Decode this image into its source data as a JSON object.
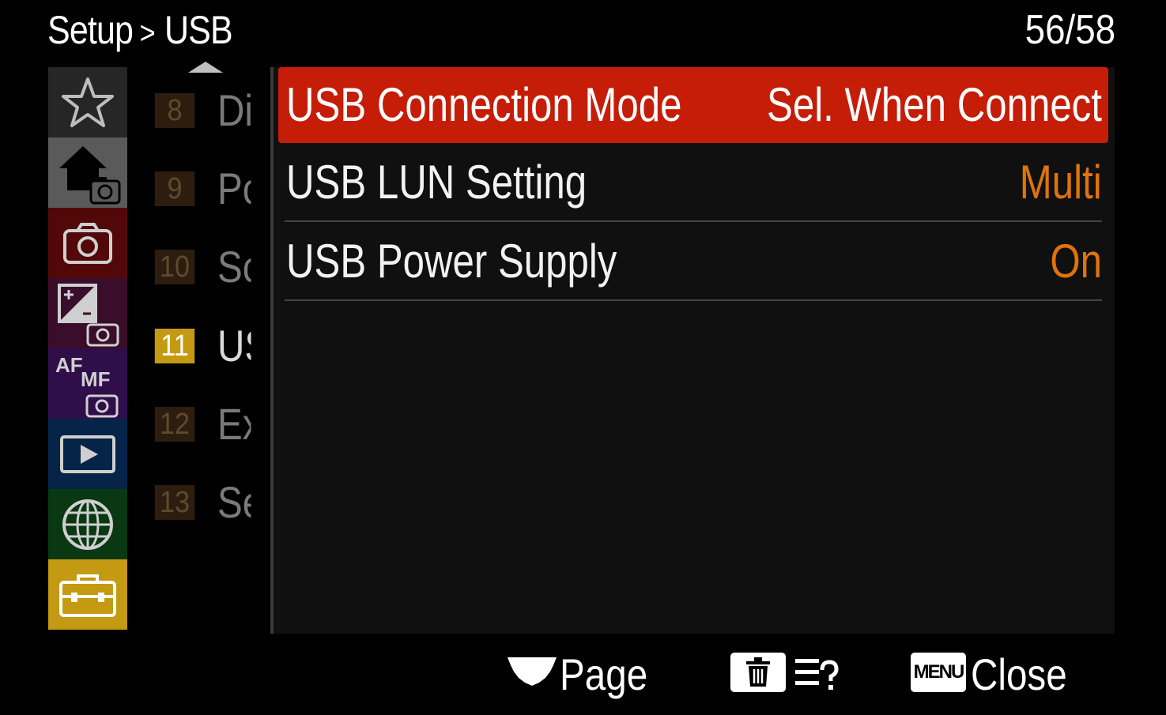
{
  "header": {
    "breadcrumb_parent": "Setup",
    "breadcrumb_separator": ">",
    "breadcrumb_current": "USB",
    "page_counter": "56/58"
  },
  "categories": [
    {
      "icon": "star-icon",
      "color": "#262626"
    },
    {
      "icon": "home-camera-icon",
      "color": "#5a5a5a"
    },
    {
      "icon": "camera-icon",
      "color": "#520808"
    },
    {
      "icon": "exposure-camera-icon",
      "color": "#3a0d2a"
    },
    {
      "icon": "af-mf-camera-icon",
      "color": "#2f0e4a",
      "af": "AF",
      "mf": "MF"
    },
    {
      "icon": "playback-icon",
      "color": "#062448"
    },
    {
      "icon": "globe-icon",
      "color": "#093812"
    },
    {
      "icon": "toolbox-icon",
      "color": "#c49a12"
    }
  ],
  "pages": [
    {
      "number": "8",
      "abbr": "Di"
    },
    {
      "number": "9",
      "abbr": "Pc"
    },
    {
      "number": "10",
      "abbr": "Sc"
    },
    {
      "number": "11",
      "abbr": "US",
      "selected": true
    },
    {
      "number": "12",
      "abbr": "Ex"
    },
    {
      "number": "13",
      "abbr": "Se"
    }
  ],
  "menu_items": [
    {
      "label": "USB Connection Mode",
      "value": "Sel. When Connect",
      "selected": true
    },
    {
      "label": "USB LUN Setting",
      "value": "Multi"
    },
    {
      "label": "USB Power Supply",
      "value": "On"
    }
  ],
  "footer": {
    "page_label": "Page",
    "menu_badge": "MENU",
    "close_label": "Close"
  },
  "colors": {
    "selection_red": "#c51d07",
    "value_orange": "#e0730a",
    "page_selected": "#c49a12"
  }
}
